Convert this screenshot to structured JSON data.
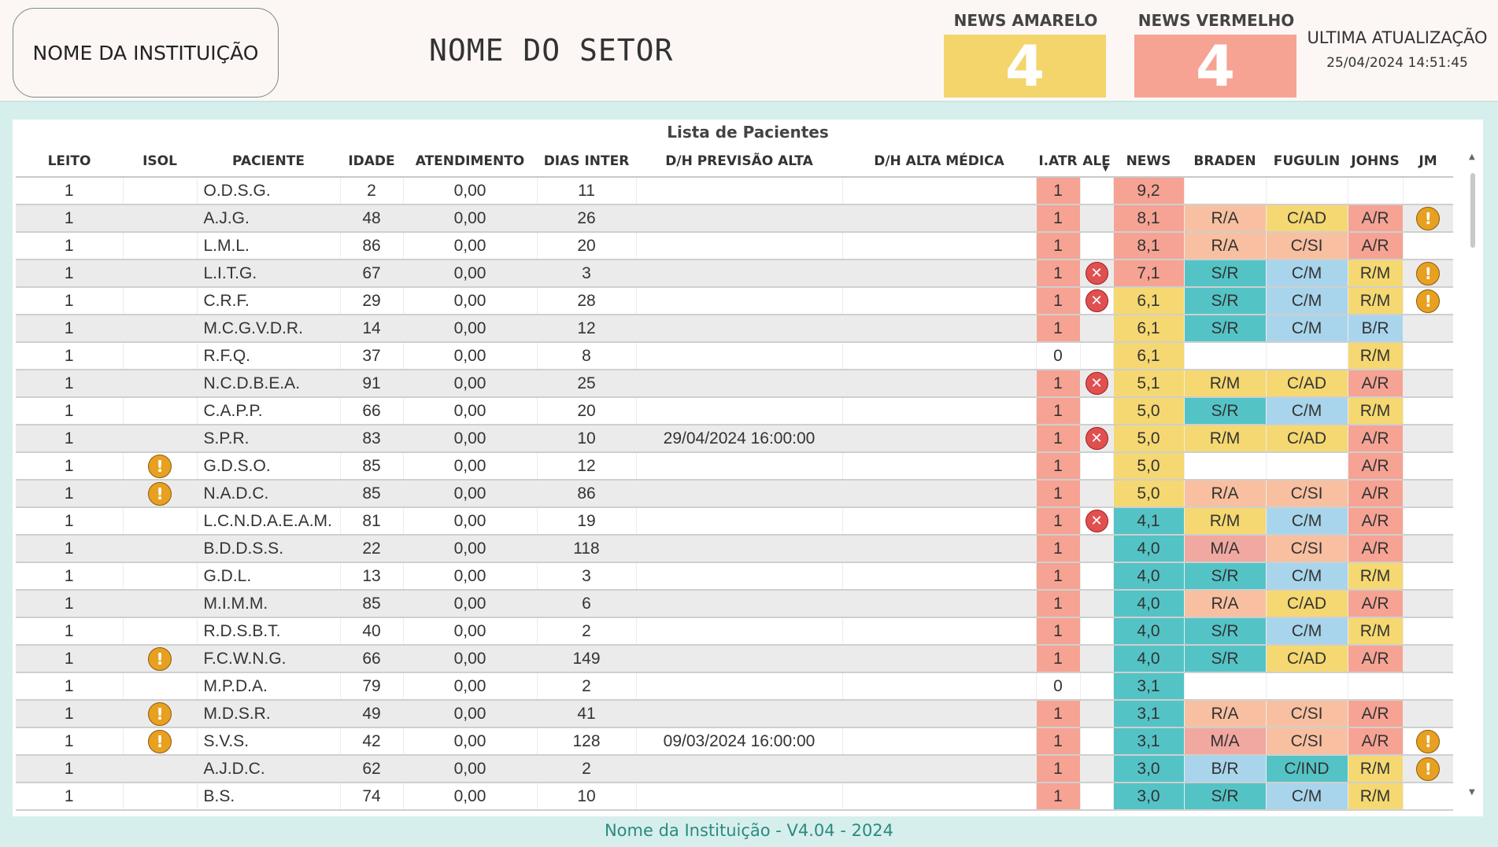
{
  "header": {
    "institution": "NOME DA INSTITUIÇÃO",
    "sector": "NOME DO SETOR",
    "news_amarelo": {
      "label": "NEWS AMARELO",
      "value": "4"
    },
    "news_vermelho": {
      "label": "NEWS VERMELHO",
      "value": "4"
    },
    "last_update": {
      "label": "ULTIMA ATUALIZAÇÃO",
      "value": "25/04/2024 14:51:45"
    }
  },
  "table": {
    "title": "Lista de Pacientes",
    "columns": [
      "LEITO",
      "ISOL",
      "PACIENTE",
      "IDADE",
      "ATENDIMENTO",
      "DIAS INTER",
      "D/H PREVISÃO ALTA",
      "D/H ALTA MÉDICA",
      "I.ATR",
      "ALE",
      "NEWS",
      "BRADEN",
      "FUGULIN",
      "JOHNS",
      "JM"
    ],
    "sorted_column": "NEWS",
    "rows": [
      {
        "leito": "1",
        "isol": false,
        "paciente": "O.D.S.G.",
        "idade": "2",
        "atendimento": "0,00",
        "dias": "11",
        "previsao": "",
        "alta": "",
        "iatr": "1",
        "ale": false,
        "news": "9,2",
        "braden": "",
        "fugulin": "",
        "johns": "",
        "jm": false
      },
      {
        "leito": "1",
        "isol": false,
        "paciente": "A.J.G.",
        "idade": "48",
        "atendimento": "0,00",
        "dias": "26",
        "previsao": "",
        "alta": "",
        "iatr": "1",
        "ale": false,
        "news": "8,1",
        "braden": "R/A",
        "fugulin": "C/AD",
        "johns": "A/R",
        "jm": true
      },
      {
        "leito": "1",
        "isol": false,
        "paciente": "L.M.L.",
        "idade": "86",
        "atendimento": "0,00",
        "dias": "20",
        "previsao": "",
        "alta": "",
        "iatr": "1",
        "ale": false,
        "news": "8,1",
        "braden": "R/A",
        "fugulin": "C/SI",
        "johns": "A/R",
        "jm": false
      },
      {
        "leito": "1",
        "isol": false,
        "paciente": "L.I.T.G.",
        "idade": "67",
        "atendimento": "0,00",
        "dias": "3",
        "previsao": "",
        "alta": "",
        "iatr": "1",
        "ale": true,
        "news": "7,1",
        "braden": "S/R",
        "fugulin": "C/M",
        "johns": "R/M",
        "jm": true
      },
      {
        "leito": "1",
        "isol": false,
        "paciente": "C.R.F.",
        "idade": "29",
        "atendimento": "0,00",
        "dias": "28",
        "previsao": "",
        "alta": "",
        "iatr": "1",
        "ale": true,
        "news": "6,1",
        "braden": "S/R",
        "fugulin": "C/M",
        "johns": "R/M",
        "jm": true
      },
      {
        "leito": "1",
        "isol": false,
        "paciente": "M.C.G.V.D.R.",
        "idade": "14",
        "atendimento": "0,00",
        "dias": "12",
        "previsao": "",
        "alta": "",
        "iatr": "1",
        "ale": false,
        "news": "6,1",
        "braden": "S/R",
        "fugulin": "C/M",
        "johns": "B/R",
        "jm": false
      },
      {
        "leito": "1",
        "isol": false,
        "paciente": "R.F.Q.",
        "idade": "37",
        "atendimento": "0,00",
        "dias": "8",
        "previsao": "",
        "alta": "",
        "iatr": "0",
        "ale": false,
        "news": "6,1",
        "braden": "",
        "fugulin": "",
        "johns": "R/M",
        "jm": false
      },
      {
        "leito": "1",
        "isol": false,
        "paciente": "N.C.D.B.E.A.",
        "idade": "91",
        "atendimento": "0,00",
        "dias": "25",
        "previsao": "",
        "alta": "",
        "iatr": "1",
        "ale": true,
        "news": "5,1",
        "braden": "R/M",
        "fugulin": "C/AD",
        "johns": "A/R",
        "jm": false
      },
      {
        "leito": "1",
        "isol": false,
        "paciente": "C.A.P.P.",
        "idade": "66",
        "atendimento": "0,00",
        "dias": "20",
        "previsao": "",
        "alta": "",
        "iatr": "1",
        "ale": false,
        "news": "5,0",
        "braden": "S/R",
        "fugulin": "C/M",
        "johns": "R/M",
        "jm": false
      },
      {
        "leito": "1",
        "isol": false,
        "paciente": "S.P.R.",
        "idade": "83",
        "atendimento": "0,00",
        "dias": "10",
        "previsao": "29/04/2024 16:00:00",
        "alta": "",
        "iatr": "1",
        "ale": true,
        "news": "5,0",
        "braden": "R/M",
        "fugulin": "C/AD",
        "johns": "A/R",
        "jm": false
      },
      {
        "leito": "1",
        "isol": true,
        "paciente": "G.D.S.O.",
        "idade": "85",
        "atendimento": "0,00",
        "dias": "12",
        "previsao": "",
        "alta": "",
        "iatr": "1",
        "ale": false,
        "news": "5,0",
        "braden": "",
        "fugulin": "",
        "johns": "A/R",
        "jm": false
      },
      {
        "leito": "1",
        "isol": true,
        "paciente": "N.A.D.C.",
        "idade": "85",
        "atendimento": "0,00",
        "dias": "86",
        "previsao": "",
        "alta": "",
        "iatr": "1",
        "ale": false,
        "news": "5,0",
        "braden": "R/A",
        "fugulin": "C/SI",
        "johns": "A/R",
        "jm": false
      },
      {
        "leito": "1",
        "isol": false,
        "paciente": "L.C.N.D.A.E.A.M.",
        "idade": "81",
        "atendimento": "0,00",
        "dias": "19",
        "previsao": "",
        "alta": "",
        "iatr": "1",
        "ale": true,
        "news": "4,1",
        "braden": "R/M",
        "fugulin": "C/M",
        "johns": "A/R",
        "jm": false
      },
      {
        "leito": "1",
        "isol": false,
        "paciente": "B.D.D.S.S.",
        "idade": "22",
        "atendimento": "0,00",
        "dias": "118",
        "previsao": "",
        "alta": "",
        "iatr": "1",
        "ale": false,
        "news": "4,0",
        "braden": "M/A",
        "fugulin": "C/SI",
        "johns": "A/R",
        "jm": false
      },
      {
        "leito": "1",
        "isol": false,
        "paciente": "G.D.L.",
        "idade": "13",
        "atendimento": "0,00",
        "dias": "3",
        "previsao": "",
        "alta": "",
        "iatr": "1",
        "ale": false,
        "news": "4,0",
        "braden": "S/R",
        "fugulin": "C/M",
        "johns": "R/M",
        "jm": false
      },
      {
        "leito": "1",
        "isol": false,
        "paciente": "M.I.M.M.",
        "idade": "85",
        "atendimento": "0,00",
        "dias": "6",
        "previsao": "",
        "alta": "",
        "iatr": "1",
        "ale": false,
        "news": "4,0",
        "braden": "R/A",
        "fugulin": "C/AD",
        "johns": "A/R",
        "jm": false
      },
      {
        "leito": "1",
        "isol": false,
        "paciente": "R.D.S.B.T.",
        "idade": "40",
        "atendimento": "0,00",
        "dias": "2",
        "previsao": "",
        "alta": "",
        "iatr": "1",
        "ale": false,
        "news": "4,0",
        "braden": "S/R",
        "fugulin": "C/M",
        "johns": "R/M",
        "jm": false
      },
      {
        "leito": "1",
        "isol": true,
        "paciente": "F.C.W.N.G.",
        "idade": "66",
        "atendimento": "0,00",
        "dias": "149",
        "previsao": "",
        "alta": "",
        "iatr": "1",
        "ale": false,
        "news": "4,0",
        "braden": "S/R",
        "fugulin": "C/AD",
        "johns": "A/R",
        "jm": false
      },
      {
        "leito": "1",
        "isol": false,
        "paciente": "M.P.D.A.",
        "idade": "79",
        "atendimento": "0,00",
        "dias": "2",
        "previsao": "",
        "alta": "",
        "iatr": "0",
        "ale": false,
        "news": "3,1",
        "braden": "",
        "fugulin": "",
        "johns": "",
        "jm": false
      },
      {
        "leito": "1",
        "isol": true,
        "paciente": "M.D.S.R.",
        "idade": "49",
        "atendimento": "0,00",
        "dias": "41",
        "previsao": "",
        "alta": "",
        "iatr": "1",
        "ale": false,
        "news": "3,1",
        "braden": "R/A",
        "fugulin": "C/SI",
        "johns": "A/R",
        "jm": false
      },
      {
        "leito": "1",
        "isol": true,
        "paciente": "S.V.S.",
        "idade": "42",
        "atendimento": "0,00",
        "dias": "128",
        "previsao": "09/03/2024 16:00:00",
        "alta": "",
        "iatr": "1",
        "ale": false,
        "news": "3,1",
        "braden": "M/A",
        "fugulin": "C/SI",
        "johns": "A/R",
        "jm": true
      },
      {
        "leito": "1",
        "isol": false,
        "paciente": "A.J.D.C.",
        "idade": "62",
        "atendimento": "0,00",
        "dias": "2",
        "previsao": "",
        "alta": "",
        "iatr": "1",
        "ale": false,
        "news": "3,0",
        "braden": "B/R",
        "fugulin": "C/IND",
        "johns": "R/M",
        "jm": true
      },
      {
        "leito": "1",
        "isol": false,
        "paciente": "B.S.",
        "idade": "74",
        "atendimento": "0,00",
        "dias": "10",
        "previsao": "",
        "alta": "",
        "iatr": "1",
        "ale": false,
        "news": "3,0",
        "braden": "S/R",
        "fugulin": "C/M",
        "johns": "R/M",
        "jm": false
      }
    ]
  },
  "icons": {
    "isol": "warning-icon",
    "ale": "x-circle-icon",
    "jm": "warning-icon",
    "warning_glyph": "!",
    "x_glyph": "✕"
  },
  "footer": "Nome da Instituição - V4.04 - 2024"
}
